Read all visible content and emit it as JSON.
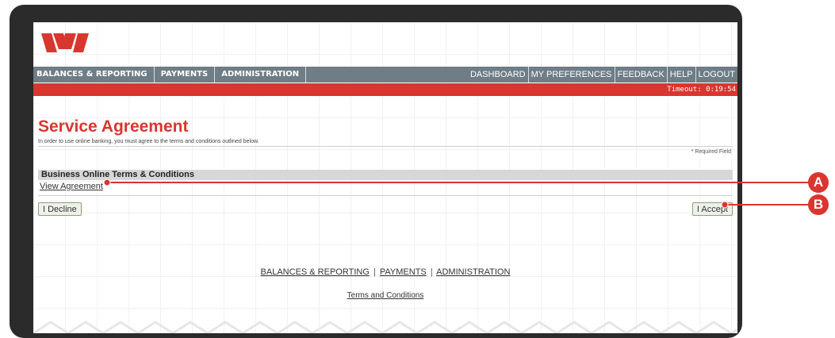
{
  "brand": {
    "logo_icon": "westpac-w-logo-icon",
    "color": "#d9362f"
  },
  "nav": {
    "left": [
      "BALANCES & REPORTING",
      "PAYMENTS",
      "ADMINISTRATION"
    ],
    "right": [
      "DASHBOARD",
      "MY PREFERENCES",
      "FEEDBACK",
      "HELP",
      "LOGOUT"
    ]
  },
  "timeout": "Timeout: 0:19:54",
  "page": {
    "title": "Service Agreement",
    "intro": "In order to use online banking, you must agree to the terms and conditions outlined below.",
    "required": "* Required Field",
    "section_title": "Business Online Terms & Conditions",
    "view_link": "View Agreement",
    "decline": "I Decline",
    "accept": "I Accept"
  },
  "footer": {
    "links": [
      "BALANCES & REPORTING",
      "PAYMENTS",
      "ADMINISTRATION"
    ],
    "separator": "|",
    "terms": "Terms and Conditions"
  },
  "callouts": {
    "a": "A",
    "b": "B",
    "color": "#d9362f"
  }
}
